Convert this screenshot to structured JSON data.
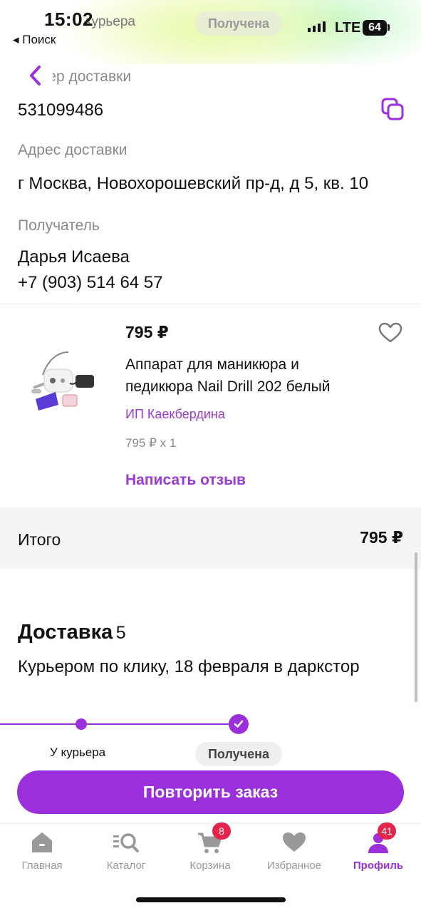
{
  "status_bar": {
    "time": "15:02",
    "back_app": "◂ Поиск",
    "network": "LTE",
    "battery": "64"
  },
  "ghost_header": {
    "courier_text": "курьера",
    "received_chip": "Получена"
  },
  "delivery_number": {
    "label": "Номер доставки",
    "value": "531099486"
  },
  "address": {
    "label": "Адрес доставки",
    "value": "г Москва, Новохорошевский пр-д, д 5, кв. 10"
  },
  "recipient": {
    "label": "Получатель",
    "name": "Дарья Исаева",
    "phone": "+7 (903) 514 64 57"
  },
  "product": {
    "price": "795 ₽",
    "name_line1": "Аппарат для маникюра и",
    "name_line2": "педикюра Nail Drill 202 белый",
    "seller": "ИП Каекбердина",
    "quantity": "795 ₽ x 1",
    "review_link": "Написать отзыв"
  },
  "total": {
    "label": "Итого",
    "value": "795 ₽"
  },
  "delivery": {
    "heading": "Доставка",
    "count": "5",
    "method": "Курьером по клику, 18 февраля в даркстор",
    "steps": [
      {
        "label": "У курьера"
      },
      {
        "label": "Получена"
      }
    ]
  },
  "repeat_button": "Повторить заказ",
  "tabs": [
    {
      "label": "Главная",
      "icon": "home-icon"
    },
    {
      "label": "Каталог",
      "icon": "catalog-icon"
    },
    {
      "label": "Корзина",
      "icon": "cart-icon",
      "badge": "8"
    },
    {
      "label": "Избранное",
      "icon": "heart-icon"
    },
    {
      "label": "Профиль",
      "icon": "profile-icon",
      "badge": "41",
      "active": true
    }
  ],
  "colors": {
    "accent": "#9b2fdb",
    "badge": "#e4244a",
    "label_gray": "#8a8a8a"
  }
}
